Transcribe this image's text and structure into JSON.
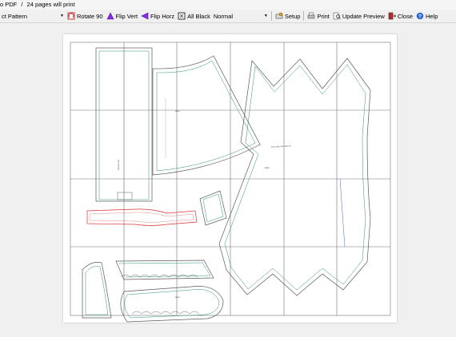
{
  "status": {
    "title": "o PDF",
    "separator": "/",
    "pages_info": "24 pages will print"
  },
  "toolbar": {
    "pattern_select": "ct Pattern",
    "rotate": "Rotate 90",
    "flip_vert": "Flip Vert",
    "flip_horz": "Flip Horz",
    "all_black": "All Black",
    "mode_select": "Normal",
    "setup": "Setup",
    "print": "Print",
    "update_preview": "Update Preview",
    "close": "Close",
    "help": "Help"
  },
  "grid": {
    "columns": 6,
    "rows": 4
  },
  "colors": {
    "toolbar_bg": "#f0f0f0",
    "sheet_bg": "#ffffff",
    "grid_line": "#707070",
    "piece_outline": "#5a5a5a",
    "seam_line": "#2f8f7f",
    "red_piece": "#e03030"
  },
  "icons": [
    "dropdown-arrow-icon",
    "rotate-icon",
    "flip-vert-icon",
    "flip-horz-icon",
    "all-black-icon",
    "setup-icon",
    "print-icon",
    "update-preview-icon",
    "close-icon",
    "help-icon"
  ]
}
